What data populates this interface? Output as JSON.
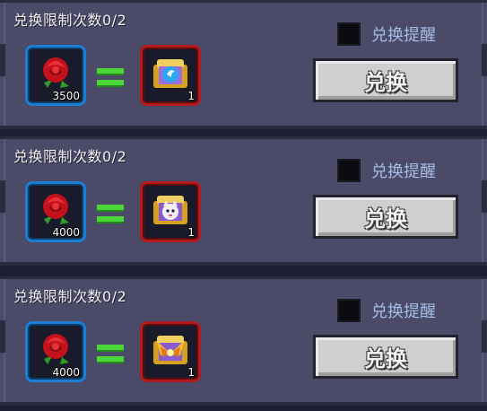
{
  "offers": [
    {
      "limit_text": "兑换限制次数0/2",
      "cost_amount": "3500",
      "reward_amount": "1",
      "reward_icon": "blue-crystal-chest-icon",
      "remind_label": "兑换提醒",
      "button_label": "兑换"
    },
    {
      "limit_text": "兑换限制次数0/2",
      "cost_amount": "4000",
      "reward_amount": "1",
      "reward_icon": "pet-chest-icon",
      "remind_label": "兑换提醒",
      "button_label": "兑换"
    },
    {
      "limit_text": "兑换限制次数0/2",
      "cost_amount": "4000",
      "reward_amount": "1",
      "reward_icon": "winged-chest-icon",
      "remind_label": "兑换提醒",
      "button_label": "兑换"
    }
  ],
  "colors": {
    "panel": "#4b4a68",
    "cost_frame": "#1b7fd6",
    "reward_frame": "#b4191e",
    "equals": "#4bd63a",
    "remind_text": "#a4bde6"
  }
}
